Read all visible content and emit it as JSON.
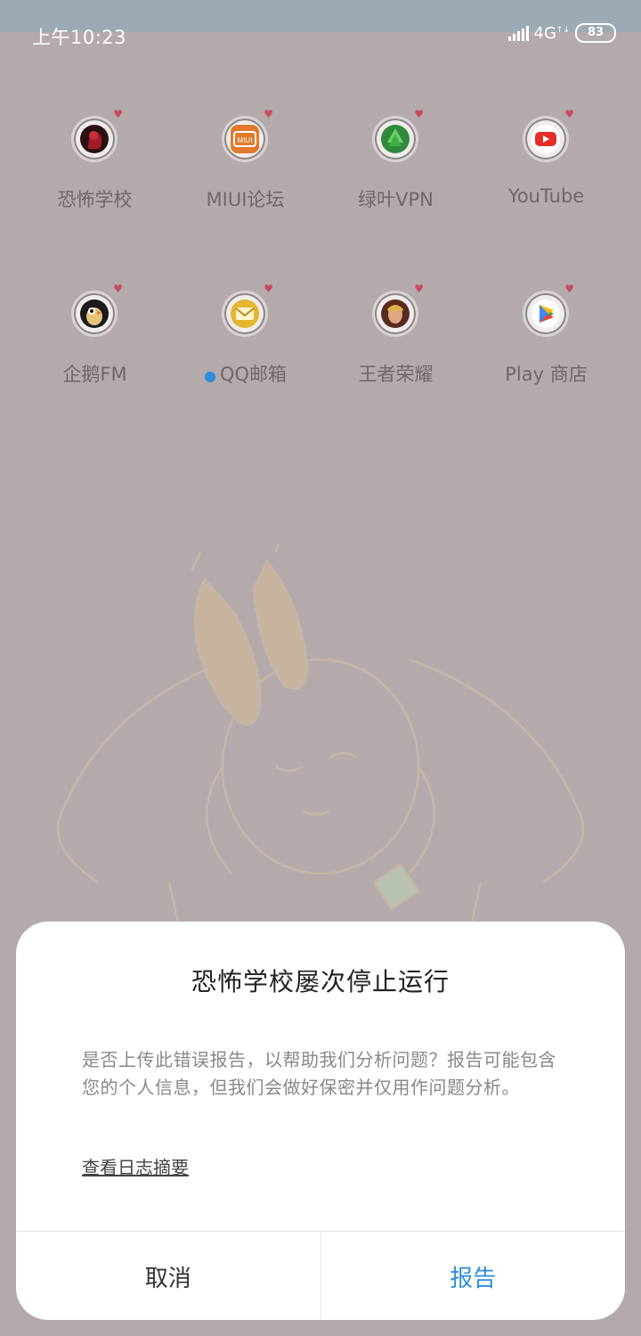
{
  "status_bar": {
    "time": "上午10:23",
    "network": "4G",
    "battery": "83"
  },
  "apps": [
    {
      "label": "恐怖学校",
      "icon": "horror-school-icon",
      "has_dot": false
    },
    {
      "label": "MIUI论坛",
      "icon": "miui-icon",
      "has_dot": false
    },
    {
      "label": "绿叶VPN",
      "icon": "leaf-vpn-icon",
      "has_dot": false
    },
    {
      "label": "YouTube",
      "icon": "youtube-icon",
      "has_dot": false
    },
    {
      "label": "企鹅FM",
      "icon": "penguin-fm-icon",
      "has_dot": false
    },
    {
      "label": "QQ邮箱",
      "icon": "mail-icon",
      "has_dot": true
    },
    {
      "label": "王者荣耀",
      "icon": "game-hero-icon",
      "has_dot": false
    },
    {
      "label": "Play 商店",
      "icon": "play-store-icon",
      "has_dot": false
    }
  ],
  "dialog": {
    "title": "恐怖学校屡次停止运行",
    "message": "是否上传此错误报告，以帮助我们分析问题？报告可能包含您的个人信息，但我们会做好保密并仅用作问题分析。",
    "link": "查看日志摘要",
    "cancel": "取消",
    "report": "报告"
  },
  "colors": {
    "accent": "#2e8dd8",
    "scrim": "#b4aaac"
  }
}
